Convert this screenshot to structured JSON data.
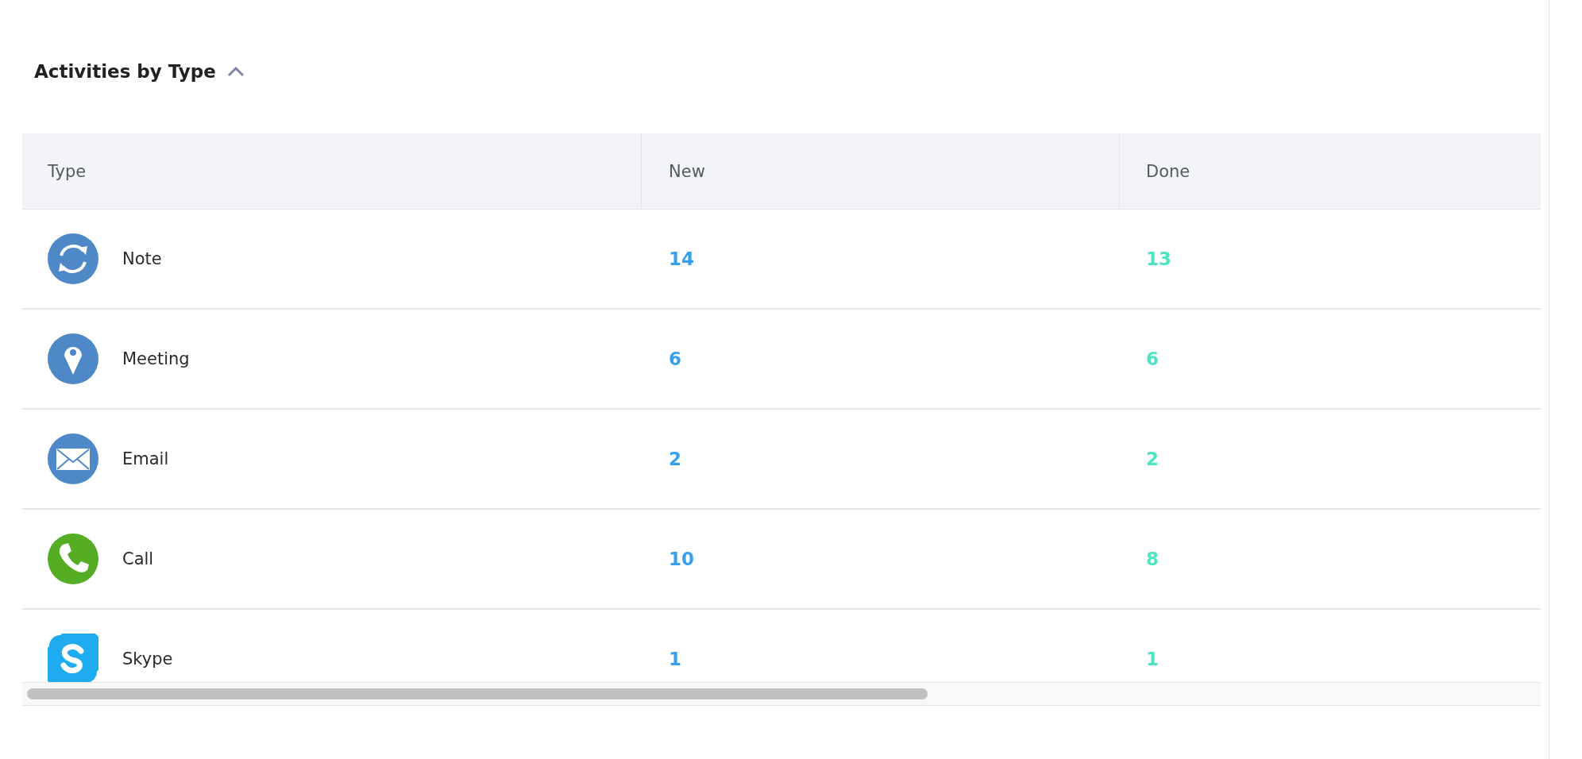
{
  "section": {
    "title": "Activities by Type",
    "expanded": true
  },
  "table": {
    "columns": [
      "Type",
      "New",
      "Done"
    ],
    "rows": [
      {
        "kind": "note",
        "type": "Note",
        "new": "14",
        "done": "13"
      },
      {
        "kind": "meeting",
        "type": "Meeting",
        "new": "6",
        "done": "6"
      },
      {
        "kind": "email",
        "type": "Email",
        "new": "2",
        "done": "2"
      },
      {
        "kind": "call",
        "type": "Call",
        "new": "10",
        "done": "8"
      },
      {
        "kind": "skype",
        "type": "Skype",
        "new": "1",
        "done": "1"
      }
    ]
  }
}
